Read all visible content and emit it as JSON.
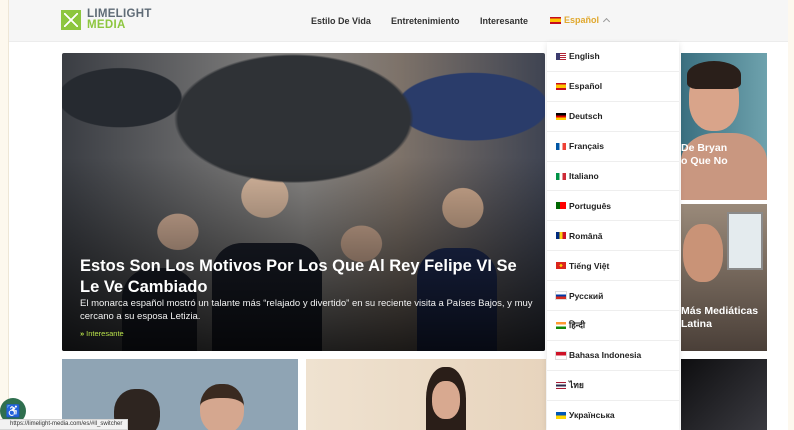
{
  "header": {
    "logo_line1": "LIMELIGHT",
    "logo_line2": "MEDIA",
    "nav": [
      "Estilo De Vida",
      "Entretenimiento",
      "Interesante"
    ],
    "current_language": "Español"
  },
  "hero": {
    "title": "Estos Son Los Motivos Por Los Que Al Rey Felipe VI Se Le Ve Cambiado",
    "excerpt": "El monarca español mostró un talante más “relajado y divertido” en su reciente visita a Países Bajos, y muy cercano a su esposa Letizia.",
    "category": "Interesante",
    "category_arrow": "»"
  },
  "side_cards": [
    {
      "title_line1": "De Bryan",
      "title_line2": "o Que No"
    },
    {
      "title_line1": "Más Mediáticas",
      "title_line2": "Latina"
    }
  ],
  "language_menu": [
    {
      "label": "English",
      "flag": "us"
    },
    {
      "label": "Español",
      "flag": "es"
    },
    {
      "label": "Deutsch",
      "flag": "de"
    },
    {
      "label": "Français",
      "flag": "fr"
    },
    {
      "label": "Italiano",
      "flag": "it"
    },
    {
      "label": "Português",
      "flag": "pt"
    },
    {
      "label": "Română",
      "flag": "ro"
    },
    {
      "label": "Tiếng Việt",
      "flag": "vn"
    },
    {
      "label": "Pусский",
      "flag": "ru"
    },
    {
      "label": "हिन्दी",
      "flag": "in"
    },
    {
      "label": "Bahasa Indonesia",
      "flag": "id"
    },
    {
      "label": "ไทย",
      "flag": "th"
    },
    {
      "label": "Українська",
      "flag": "ua"
    }
  ],
  "status_bar": "https://limelight-media.com/es/#ll_switcher",
  "badge_icon": "accessibility-icon",
  "colors": {
    "brand_green": "#8dc63f",
    "accent_gold": "#e0a82e",
    "hero_category": "#b7e04a"
  }
}
